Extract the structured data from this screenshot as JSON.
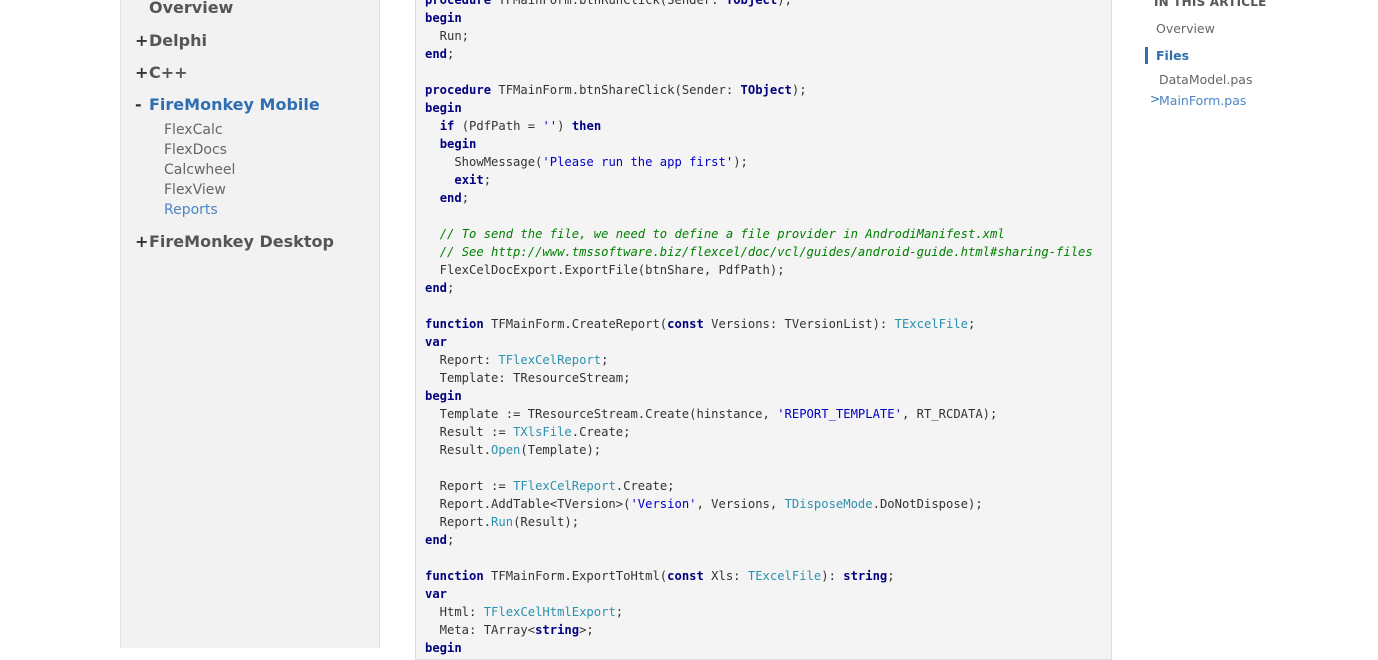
{
  "sidebar": {
    "overview": "Overview",
    "sections": [
      {
        "toggle": "+",
        "label": "Delphi"
      },
      {
        "toggle": "+",
        "label": "C++"
      },
      {
        "toggle": "-",
        "label": "FireMonkey Mobile"
      },
      {
        "toggle": "+",
        "label": "FireMonkey Desktop"
      }
    ],
    "sub_items": [
      "FlexCalc",
      "FlexDocs",
      "Calcwheel",
      "FlexView",
      "Reports"
    ],
    "active_sub_item": "Reports"
  },
  "code": {
    "language": "Delphi",
    "lines": [
      "procedure TFMainForm.btnRunClick(Sender: TObject);",
      "begin",
      "  Run;",
      "end;",
      "",
      "procedure TFMainForm.btnShareClick(Sender: TObject);",
      "begin",
      "  if (PdfPath = '') then",
      "  begin",
      "    ShowMessage('Please run the app first');",
      "    exit;",
      "  end;",
      "",
      "  // To send the file, we need to define a file provider in AndrodiManifest.xml",
      "  // See http://www.tmssoftware.biz/flexcel/doc/vcl/guides/android-guide.html#sharing-files",
      "  FlexCelDocExport.ExportFile(btnShare, PdfPath);",
      "end;",
      "",
      "function TFMainForm.CreateReport(const Versions: TVersionList): TExcelFile;",
      "var",
      "  Report: TFlexCelReport;",
      "  Template: TResourceStream;",
      "begin",
      "  Template := TResourceStream.Create(hinstance, 'REPORT_TEMPLATE', RT_RCDATA);",
      "  Result := TXlsFile.Create;",
      "  Result.Open(Template);",
      "",
      "  Report := TFlexCelReport.Create;",
      "  Report.AddTable<TVersion>('Version', Versions, TDisposeMode.DoNotDispose);",
      "  Report.Run(Result);",
      "end;",
      "",
      "function TFMainForm.ExportToHtml(const Xls: TExcelFile): string;",
      "var",
      "  Html: TFlexCelHtmlExport;",
      "  Meta: TArray<string>;",
      "begin"
    ]
  },
  "toc": {
    "title": "IN THIS ARTICLE",
    "items": [
      "Overview",
      "Files",
      "DataModel.pas",
      "MainForm.pas"
    ],
    "active": "Files",
    "chevron": ">"
  },
  "colors": {
    "accent": "#2f6fb1",
    "keyword": "#000080",
    "type": "#2b91af",
    "string": "#0000c8",
    "comment": "#008000",
    "sidebar_bg": "#f2f2f2",
    "code_bg": "#f4f4f4"
  }
}
